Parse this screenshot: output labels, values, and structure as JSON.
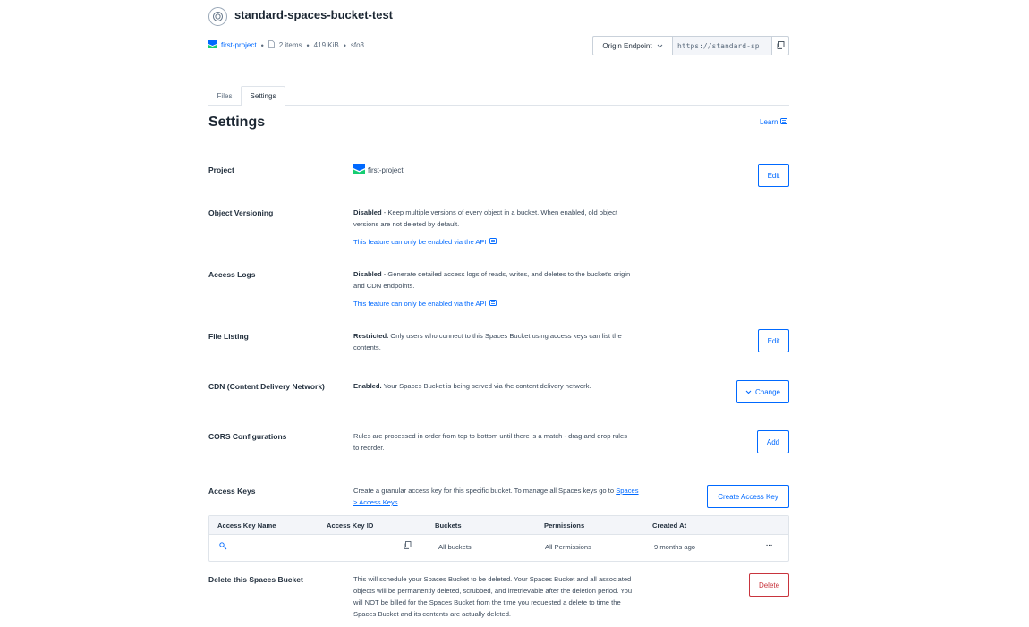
{
  "bucket": {
    "name": "standard-spaces-bucket-test",
    "project": "first-project",
    "items": "2 items",
    "size": "419 KiB",
    "region": "sfo3"
  },
  "endpoint": {
    "selector_label": "Origin Endpoint",
    "url": "https://standard-sp"
  },
  "tabs": [
    {
      "label": "Files",
      "active": false
    },
    {
      "label": "Settings",
      "active": true
    }
  ],
  "page": {
    "title": "Settings",
    "learn_label": "Learn"
  },
  "settings": {
    "project": {
      "label": "Project",
      "value": "first-project",
      "button": "Edit"
    },
    "versioning": {
      "label": "Object Versioning",
      "status": "Disabled",
      "text": " - Keep multiple versions of every object in a bucket. When enabled, old object versions are not deleted by default.",
      "note": "This feature can only be enabled via the API"
    },
    "access_logs": {
      "label": "Access Logs",
      "status": "Disabled",
      "text": " - Generate detailed access logs of reads, writes, and deletes to the bucket's origin and CDN endpoints.",
      "note": "This feature can only be enabled via the API"
    },
    "file_listing": {
      "label": "File Listing",
      "status": "Restricted.",
      "text": " Only users who connect to this Spaces Bucket using access keys can list the contents.",
      "button": "Edit"
    },
    "cdn": {
      "label": "CDN (Content Delivery Network)",
      "status": "Enabled.",
      "text": " Your Spaces Bucket is being served via the content delivery network.",
      "button": "Change"
    },
    "cors": {
      "label": "CORS Configurations",
      "text": "Rules are processed in order from top to bottom until there is a match - drag and drop rules to reorder.",
      "button": "Add"
    },
    "access_keys": {
      "label": "Access Keys",
      "text": "Create a granular access key for this specific bucket. To manage all Spaces keys go to ",
      "link": "Spaces > Access Keys",
      "button": "Create Access Key",
      "columns": [
        "Access Key Name",
        "Access Key ID",
        "Buckets",
        "Permissions",
        "Created At"
      ],
      "rows": [
        {
          "name": "",
          "id": "",
          "buckets": "All buckets",
          "permissions": "All Permissions",
          "created": "9 months ago"
        }
      ],
      "row_menu": "···"
    },
    "delete": {
      "label": "Delete this Spaces Bucket",
      "text": "This will schedule your Spaces Bucket to be deleted. Your Spaces Bucket and all associated objects will be permanently deleted, scrubbed, and irretrievable after the deletion period. You will NOT be billed for the Spaces Bucket from the time you requested a delete to time the Spaces Bucket and its contents are actually deleted.",
      "button": "Delete"
    }
  },
  "colors": {
    "accent": "#0069ff",
    "danger": "#c8343d",
    "text": "#24313f"
  }
}
